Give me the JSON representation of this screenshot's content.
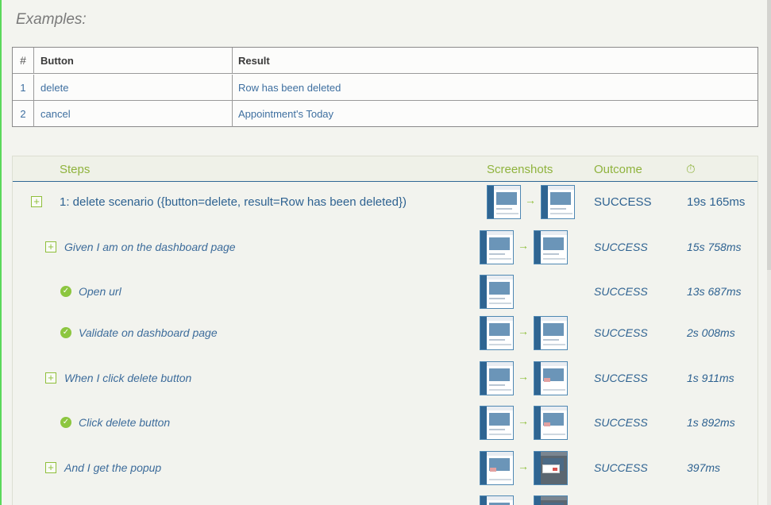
{
  "examples": {
    "title": "Examples:",
    "headers": [
      "#",
      "Button",
      "Result"
    ],
    "rows": [
      [
        "1",
        "delete",
        "Row has been deleted"
      ],
      [
        "2",
        "cancel",
        "Appointment's Today"
      ]
    ]
  },
  "steps_table": {
    "headers": {
      "steps": "Steps",
      "screenshots": "Screenshots",
      "outcome": "Outcome",
      "duration_icon": "stopwatch-icon",
      "duration_glyph": "⏱"
    },
    "arrow_glyph": "→",
    "expand_glyph": "+",
    "check_glyph": "✓",
    "rows": [
      {
        "label": "1: delete scenario ({button=delete, result=Row has been deleted})",
        "outcome": "SUCCESS",
        "duration": "19s 165ms"
      },
      {
        "label": "Given I am on the dashboard page",
        "outcome": "SUCCESS",
        "duration": "15s 758ms"
      },
      {
        "label": "Open url",
        "outcome": "SUCCESS",
        "duration": "13s 687ms"
      },
      {
        "label": "Validate on dashboard page",
        "outcome": "SUCCESS",
        "duration": "2s 008ms"
      },
      {
        "label": "When I click delete button",
        "outcome": "SUCCESS",
        "duration": "1s 911ms"
      },
      {
        "label": "Click delete button",
        "outcome": "SUCCESS",
        "duration": "1s 892ms"
      },
      {
        "label": "And I get the popup",
        "outcome": "SUCCESS",
        "duration": "397ms"
      }
    ]
  },
  "colors": {
    "accent_green": "#8fbf3b",
    "link_blue": "#2e6291",
    "page_bg": "#f3f4ef"
  }
}
